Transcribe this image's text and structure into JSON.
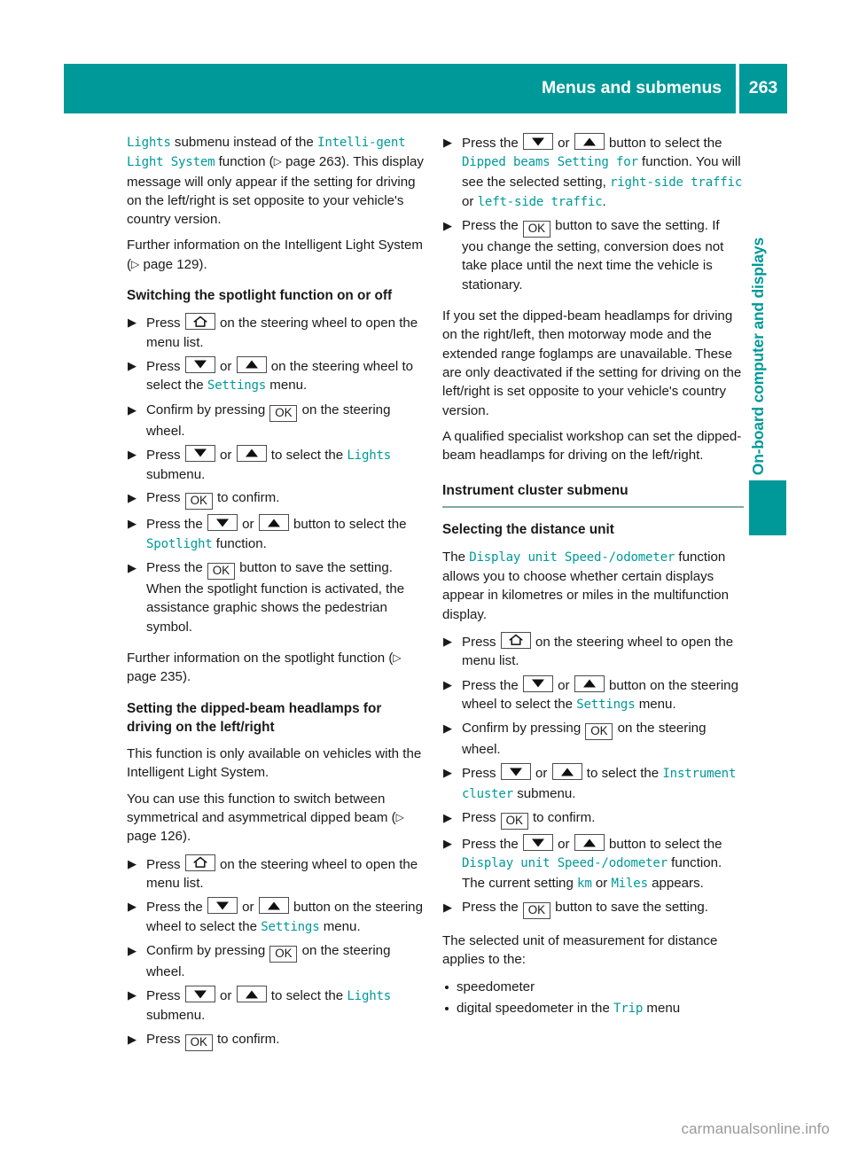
{
  "header": {
    "title": "Menus and submenus",
    "page_number": "263",
    "bar_color": "#009999"
  },
  "side_tab": {
    "label": "On-board computer and displays",
    "color": "#009999"
  },
  "icons": {
    "home": "home-icon",
    "down": "arrow-down-icon",
    "up": "arrow-up-icon",
    "ok": "OK",
    "page_ref_arrow": "▷",
    "step_marker": "▶"
  },
  "left_column": {
    "para_1": {
      "t1": "Lights",
      "t2": " submenu instead of the ",
      "t3": "Intelli-gent Light System",
      "t4": " function (",
      "t5": "▷",
      "t6": " page 263). This display message will only appear if the setting for driving on the left/right is set opposite to your vehicle's country version."
    },
    "para_2": {
      "t1": "Further information on the Intelligent Light System (",
      "t2": "▷",
      "t3": " page 129)."
    },
    "heading_spotlight": "Switching the spotlight function on or off",
    "steps_spotlight": [
      {
        "parts": [
          {
            "type": "text",
            "value": "Press "
          },
          {
            "type": "key-home",
            "value": ""
          },
          {
            "type": "text",
            "value": " on the steering wheel to open the menu list."
          }
        ]
      },
      {
        "parts": [
          {
            "type": "text",
            "value": "Press "
          },
          {
            "type": "key-down",
            "value": ""
          },
          {
            "type": "text",
            "value": " or "
          },
          {
            "type": "key-up",
            "value": ""
          },
          {
            "type": "text",
            "value": " on the steering wheel to select the "
          },
          {
            "type": "menu",
            "value": "Settings"
          },
          {
            "type": "text",
            "value": " menu."
          }
        ]
      },
      {
        "parts": [
          {
            "type": "text",
            "value": "Confirm by pressing "
          },
          {
            "type": "key-ok",
            "value": "OK"
          },
          {
            "type": "text",
            "value": " on the steering wheel."
          }
        ]
      },
      {
        "parts": [
          {
            "type": "text",
            "value": "Press "
          },
          {
            "type": "key-down",
            "value": ""
          },
          {
            "type": "text",
            "value": " or "
          },
          {
            "type": "key-up",
            "value": ""
          },
          {
            "type": "text",
            "value": " to select the "
          },
          {
            "type": "menu",
            "value": "Lights"
          },
          {
            "type": "text",
            "value": " submenu."
          }
        ]
      },
      {
        "parts": [
          {
            "type": "text",
            "value": "Press "
          },
          {
            "type": "key-ok",
            "value": "OK"
          },
          {
            "type": "text",
            "value": " to confirm."
          }
        ]
      },
      {
        "parts": [
          {
            "type": "text",
            "value": "Press the "
          },
          {
            "type": "key-down",
            "value": ""
          },
          {
            "type": "text",
            "value": " or "
          },
          {
            "type": "key-up",
            "value": ""
          },
          {
            "type": "text",
            "value": " button to select the "
          },
          {
            "type": "menu",
            "value": "Spotlight"
          },
          {
            "type": "text",
            "value": " function."
          }
        ]
      },
      {
        "parts": [
          {
            "type": "text",
            "value": "Press the "
          },
          {
            "type": "key-ok",
            "value": "OK"
          },
          {
            "type": "text",
            "value": " button to save the setting. When the spotlight function is activated, the assistance graphic shows the pedestrian symbol."
          }
        ]
      }
    ],
    "para_3": {
      "t1": "Further information on the spotlight function (",
      "t2": "▷",
      "t3": " page 235)."
    },
    "heading_dipped": "Setting the dipped-beam headlamps for driving on the left/right",
    "para_4": "This function is only available on vehicles with the Intelligent Light System.",
    "para_5": {
      "t1": "You can use this function to switch between symmetrical and asymmetrical dipped beam (",
      "t2": "▷",
      "t3": " page 126)."
    },
    "steps_dipped": [
      {
        "parts": [
          {
            "type": "text",
            "value": "Press "
          },
          {
            "type": "key-home",
            "value": ""
          },
          {
            "type": "text",
            "value": " on the steering wheel to open the menu list."
          }
        ]
      },
      {
        "parts": [
          {
            "type": "text",
            "value": "Press the "
          },
          {
            "type": "key-down",
            "value": ""
          },
          {
            "type": "text",
            "value": " or "
          },
          {
            "type": "key-up",
            "value": ""
          },
          {
            "type": "text",
            "value": " button on the steering wheel to select the "
          },
          {
            "type": "menu",
            "value": "Settings"
          },
          {
            "type": "text",
            "value": " menu."
          }
        ]
      },
      {
        "parts": [
          {
            "type": "text",
            "value": "Confirm by pressing "
          },
          {
            "type": "key-ok",
            "value": "OK"
          },
          {
            "type": "text",
            "value": " on the steering wheel."
          }
        ]
      },
      {
        "parts": [
          {
            "type": "text",
            "value": "Press "
          },
          {
            "type": "key-down",
            "value": ""
          },
          {
            "type": "text",
            "value": " or "
          },
          {
            "type": "key-up",
            "value": ""
          },
          {
            "type": "text",
            "value": " to select the "
          },
          {
            "type": "menu",
            "value": "Lights"
          },
          {
            "type": "text",
            "value": " submenu."
          }
        ]
      },
      {
        "parts": [
          {
            "type": "text",
            "value": "Press "
          },
          {
            "type": "key-ok",
            "value": "OK"
          },
          {
            "type": "text",
            "value": " to confirm."
          }
        ]
      }
    ]
  },
  "right_column": {
    "steps_top": [
      {
        "parts": [
          {
            "type": "text",
            "value": "Press the "
          },
          {
            "type": "key-down",
            "value": ""
          },
          {
            "type": "text",
            "value": " or "
          },
          {
            "type": "key-up",
            "value": ""
          },
          {
            "type": "text",
            "value": " button to select the "
          },
          {
            "type": "menu",
            "value": "Dipped beams Setting for"
          },
          {
            "type": "text",
            "value": " function. You will see the selected setting, "
          },
          {
            "type": "menu",
            "value": "right-side traffic"
          },
          {
            "type": "text",
            "value": " or "
          },
          {
            "type": "menu",
            "value": "left-side traffic"
          },
          {
            "type": "text",
            "value": "."
          }
        ]
      },
      {
        "parts": [
          {
            "type": "text",
            "value": "Press the "
          },
          {
            "type": "key-ok",
            "value": "OK"
          },
          {
            "type": "text",
            "value": " button to save the setting. If you change the setting, conversion does not take place until the next time the vehicle is stationary."
          }
        ]
      }
    ],
    "para_1": "If you set the dipped-beam headlamps for driving on the right/left, then motorway mode and the extended range foglamps are unavailable. These are only deactivated if the setting for driving on the left/right is set opposite to your vehicle's country version.",
    "para_2": "A qualified specialist workshop can set the dipped-beam headlamps for driving on the left/right.",
    "section_heading": "Instrument cluster submenu",
    "sub_heading": "Selecting the distance unit",
    "para_3": {
      "t1": "The ",
      "t2": "Display unit Speed-/odometer",
      "t3": " function allows you to choose whether certain displays appear in kilometres or miles in the multifunction display."
    },
    "steps_bottom": [
      {
        "parts": [
          {
            "type": "text",
            "value": "Press "
          },
          {
            "type": "key-home",
            "value": ""
          },
          {
            "type": "text",
            "value": " on the steering wheel to open the menu list."
          }
        ]
      },
      {
        "parts": [
          {
            "type": "text",
            "value": "Press the "
          },
          {
            "type": "key-down",
            "value": ""
          },
          {
            "type": "text",
            "value": " or "
          },
          {
            "type": "key-up",
            "value": ""
          },
          {
            "type": "text",
            "value": " button on the steering wheel to select the "
          },
          {
            "type": "menu",
            "value": "Settings"
          },
          {
            "type": "text",
            "value": " menu."
          }
        ]
      },
      {
        "parts": [
          {
            "type": "text",
            "value": "Confirm by pressing "
          },
          {
            "type": "key-ok",
            "value": "OK"
          },
          {
            "type": "text",
            "value": " on the steering wheel."
          }
        ]
      },
      {
        "parts": [
          {
            "type": "text",
            "value": "Press "
          },
          {
            "type": "key-down",
            "value": ""
          },
          {
            "type": "text",
            "value": " or "
          },
          {
            "type": "key-up",
            "value": ""
          },
          {
            "type": "text",
            "value": " to select the "
          },
          {
            "type": "menu",
            "value": "Instrument cluster"
          },
          {
            "type": "text",
            "value": " submenu."
          }
        ]
      },
      {
        "parts": [
          {
            "type": "text",
            "value": "Press "
          },
          {
            "type": "key-ok",
            "value": "OK"
          },
          {
            "type": "text",
            "value": " to confirm."
          }
        ]
      },
      {
        "parts": [
          {
            "type": "text",
            "value": "Press the "
          },
          {
            "type": "key-down",
            "value": ""
          },
          {
            "type": "text",
            "value": " or "
          },
          {
            "type": "key-up",
            "value": ""
          },
          {
            "type": "text",
            "value": " button to select the "
          },
          {
            "type": "menu",
            "value": "Display unit Speed-/odometer"
          },
          {
            "type": "text",
            "value": " function. The current setting "
          },
          {
            "type": "menu",
            "value": "km"
          },
          {
            "type": "text",
            "value": " or "
          },
          {
            "type": "menu",
            "value": "Miles"
          },
          {
            "type": "text",
            "value": " appears."
          }
        ]
      },
      {
        "parts": [
          {
            "type": "text",
            "value": "Press the "
          },
          {
            "type": "key-ok",
            "value": "OK"
          },
          {
            "type": "text",
            "value": " button to save the setting."
          }
        ]
      }
    ],
    "para_4": "The selected unit of measurement for distance applies to the:",
    "bullets": [
      {
        "parts": [
          {
            "type": "text",
            "value": "speedometer"
          }
        ]
      },
      {
        "parts": [
          {
            "type": "text",
            "value": "digital speedometer in the "
          },
          {
            "type": "menu",
            "value": "Trip"
          },
          {
            "type": "text",
            "value": " menu"
          }
        ]
      }
    ]
  },
  "footer": {
    "watermark": "carmanualsonline.info"
  }
}
